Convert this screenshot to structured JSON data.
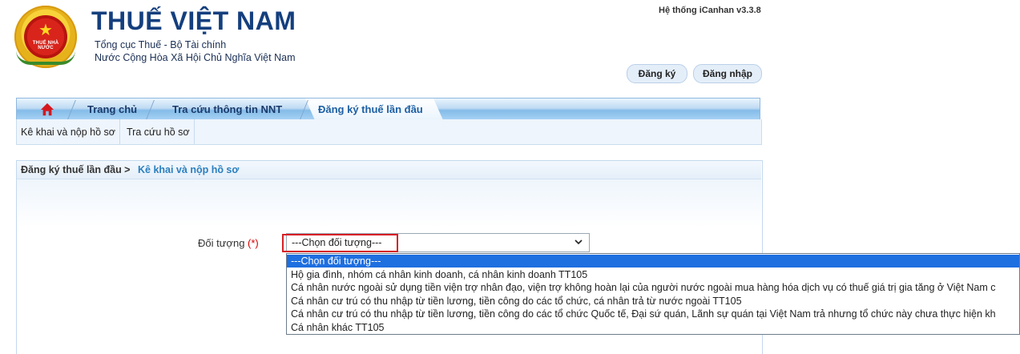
{
  "header": {
    "logo_text": "THUẾ NHÀ NƯỚC",
    "site_title": "THUẾ VIỆT NAM",
    "subtitle_1": "Tổng cục Thuế - Bộ Tài chính",
    "subtitle_2": "Nước Cộng Hòa Xã Hội Chủ Nghĩa Việt Nam",
    "version": "Hệ thống iCanhan v3.3.8",
    "register_label": "Đăng ký",
    "login_label": "Đăng nhập"
  },
  "nav": {
    "items": [
      {
        "label": "Trang chủ"
      },
      {
        "label": "Tra cứu thông tin NNT"
      },
      {
        "label": "Đăng ký thuế lần đầu"
      }
    ],
    "active_index": 2
  },
  "subnav": {
    "items": [
      {
        "label": "Kê khai và nộp hồ sơ"
      },
      {
        "label": "Tra cứu hồ sơ"
      }
    ]
  },
  "breadcrumb": {
    "parent": "Đăng ký thuế lần đầu >",
    "current": "Kê khai và nộp hồ sơ"
  },
  "form": {
    "label": "Đối tượng",
    "required_mark": "(*)",
    "selected_value": "---Chọn đối tượng---",
    "options": [
      "---Chọn đối tượng---",
      "Hộ gia đình, nhóm cá nhân kinh doanh, cá nhân kinh doanh TT105",
      "Cá nhân nước ngoài sử dụng tiền viện trợ nhân đạo, viện trợ không hoàn lại của người nước ngoài mua hàng hóa dịch vụ có thuế giá trị gia tăng ở Việt Nam c",
      "Cá nhân cư trú có thu nhập từ tiền lương, tiền công do các tổ chức, cá nhân trả từ nước ngoài TT105",
      "Cá nhân cư trú có thu nhập từ tiền lương, tiền công do các tổ chức Quốc tế, Đại sứ quán, Lãnh sự quán tại Việt Nam trả nhưng tổ chức này chưa thực hiện kh",
      "Cá nhân khác TT105"
    ],
    "highlighted_option_index": 0
  },
  "colors": {
    "brand_blue": "#143f7e",
    "link_blue": "#2a7fbf",
    "required_red": "#d40000",
    "highlight_red": "#d81f26",
    "selection_blue": "#1e6fe0"
  },
  "icons": {
    "home": "home-icon",
    "dropdown": "chevron-down-icon"
  }
}
